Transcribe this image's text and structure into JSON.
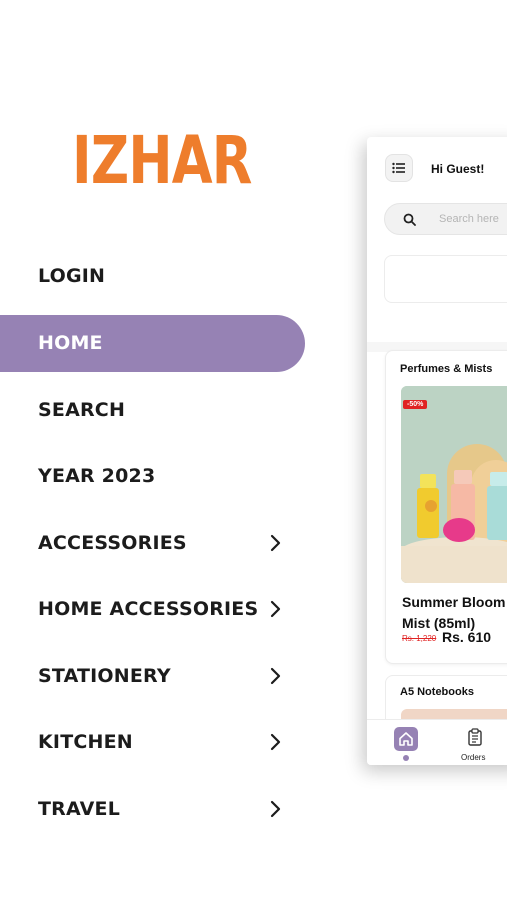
{
  "brand": {
    "logo_text": "IZHAR",
    "accent": "#ee7d2c",
    "menu_active_color": "#9682b4"
  },
  "menu": {
    "items": [
      {
        "label": "LOGIN",
        "has_submenu": false,
        "active": false
      },
      {
        "label": "HOME",
        "has_submenu": false,
        "active": true
      },
      {
        "label": "SEARCH",
        "has_submenu": false,
        "active": false
      },
      {
        "label": "YEAR 2023",
        "has_submenu": false,
        "active": false
      },
      {
        "label": "ACCESSORIES",
        "has_submenu": true,
        "active": false
      },
      {
        "label": "HOME ACCESSORIES",
        "has_submenu": true,
        "active": false
      },
      {
        "label": "STATIONERY",
        "has_submenu": true,
        "active": false
      },
      {
        "label": "KITCHEN",
        "has_submenu": true,
        "active": false
      },
      {
        "label": "TRAVEL",
        "has_submenu": true,
        "active": false
      }
    ],
    "chevron_icon": "chevron-right-icon"
  },
  "phone": {
    "greeting": "Hi Guest!",
    "search_placeholder": "Search here",
    "section1_title": "Perfumes & Mists",
    "product": {
      "discount": "-50%",
      "name": "Summer Bloom Mist (85ml)",
      "old_price": "Rs. 1,220",
      "price": "Rs. 610"
    },
    "section2_title": "A5 Notebooks",
    "tabs": [
      {
        "label": "",
        "icon": "home-icon",
        "active": true
      },
      {
        "label": "Orders",
        "icon": "orders-icon",
        "active": false
      }
    ]
  }
}
